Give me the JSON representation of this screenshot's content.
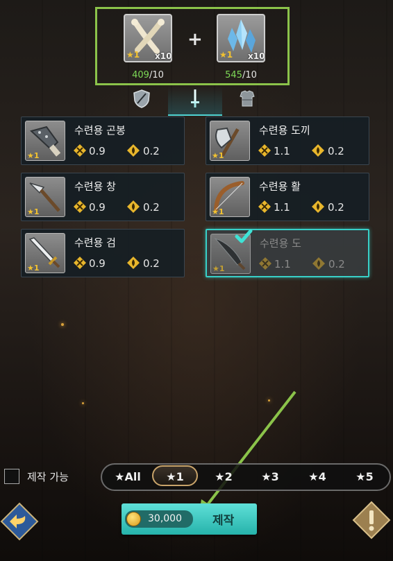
{
  "materials": [
    {
      "name": "bone",
      "stars": "1",
      "qty": "x10",
      "have": "409",
      "need": "/10"
    },
    {
      "name": "crystal",
      "stars": "1",
      "qty": "x10",
      "have": "545",
      "need": "/10"
    }
  ],
  "plus_sign": "+",
  "tabs": [
    {
      "icon": "shield-icon",
      "active": false
    },
    {
      "icon": "sword-icon",
      "active": true
    },
    {
      "icon": "armor-icon",
      "active": false
    }
  ],
  "items": [
    {
      "name": "수련용 곤봉",
      "stars": "1",
      "attack": "0.9",
      "special": "0.2",
      "icon": "club-icon",
      "selected": false
    },
    {
      "name": "수련용 도끼",
      "stars": "1",
      "attack": "1.1",
      "special": "0.2",
      "icon": "axe-icon",
      "selected": false
    },
    {
      "name": "수련용 창",
      "stars": "1",
      "attack": "0.9",
      "special": "0.2",
      "icon": "spear-icon",
      "selected": false
    },
    {
      "name": "수련용 활",
      "stars": "1",
      "attack": "1.1",
      "special": "0.2",
      "icon": "bow-icon",
      "selected": false
    },
    {
      "name": "수련용 검",
      "stars": "1",
      "attack": "0.9",
      "special": "0.2",
      "icon": "sword-blade-icon",
      "selected": false
    },
    {
      "name": "수련용 도",
      "stars": "1",
      "attack": "1.1",
      "special": "0.2",
      "icon": "machete-icon",
      "selected": true
    }
  ],
  "craftable_filter": {
    "label": "제작 가능",
    "checked": false
  },
  "star_filters": [
    {
      "label": "★All",
      "active": false
    },
    {
      "label": "★1",
      "active": true
    },
    {
      "label": "★2",
      "active": false
    },
    {
      "label": "★3",
      "active": false
    },
    {
      "label": "★4",
      "active": false
    },
    {
      "label": "★5",
      "active": false
    }
  ],
  "craft_button": {
    "cost": "30,000",
    "label": "제작"
  },
  "colors": {
    "accent": "#38d0c8",
    "highlight": "#8bc34a",
    "have_count": "#7ed957",
    "star": "#f2c230"
  }
}
